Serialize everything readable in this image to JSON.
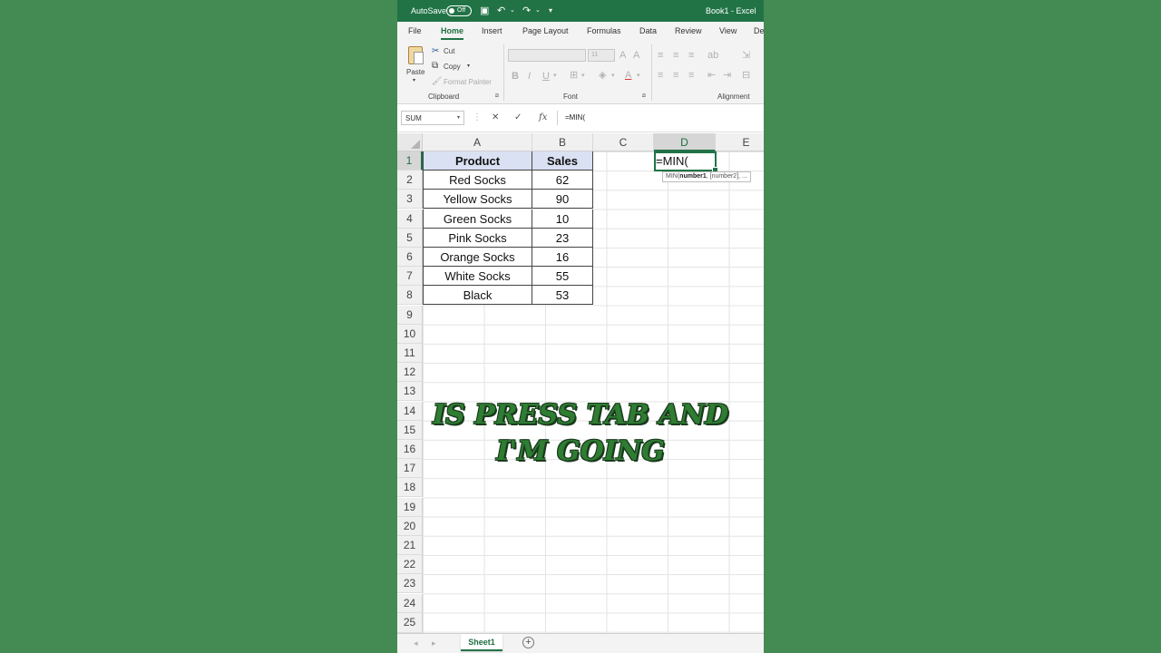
{
  "titlebar": {
    "autosave_label": "AutoSave",
    "autosave_state": "Off",
    "document": "Book1 - Excel"
  },
  "ribbon_tabs": [
    "File",
    "Home",
    "Insert",
    "Page Layout",
    "Formulas",
    "Data",
    "Review",
    "View",
    "De"
  ],
  "active_tab": "Home",
  "clipboard": {
    "paste": "Paste",
    "cut": "Cut",
    "copy": "Copy",
    "format_painter": "Format Painter",
    "group_label": "Clipboard"
  },
  "font": {
    "size": "11",
    "group_label": "Font",
    "bold": "B",
    "italic": "I",
    "underline": "U",
    "font_color": "A"
  },
  "alignment": {
    "group_label": "Alignment"
  },
  "formula_bar": {
    "name_box": "SUM",
    "cancel": "✕",
    "enter": "✓",
    "fx": "fx",
    "formula": "=MIN("
  },
  "columns": [
    "A",
    "B",
    "C",
    "D",
    "E"
  ],
  "rows": [
    "1",
    "2",
    "3",
    "4",
    "5",
    "6",
    "7",
    "8",
    "9",
    "10",
    "11",
    "12",
    "13",
    "14",
    "15",
    "16",
    "17",
    "18",
    "19",
    "20",
    "21",
    "22",
    "23",
    "24",
    "25"
  ],
  "table": {
    "headers": [
      "Product",
      "Sales"
    ],
    "rows": [
      [
        "Red Socks",
        "62"
      ],
      [
        "Yellow Socks",
        "90"
      ],
      [
        "Green Socks",
        "10"
      ],
      [
        "Pink Socks",
        "23"
      ],
      [
        "Orange Socks",
        "16"
      ],
      [
        "White Socks",
        "55"
      ],
      [
        "Black",
        "53"
      ]
    ]
  },
  "active_cell": {
    "ref": "D1",
    "content": "=MIN(",
    "tooltip_fn": "MIN(",
    "tooltip_arg1": "number1",
    "tooltip_rest": ", [number2], ..."
  },
  "caption": {
    "line1": "IS PRESS TAB AND",
    "line2": "I'M GOING"
  },
  "sheets": [
    "Sheet1"
  ],
  "colors": {
    "accent": "#217346",
    "background": "#448a53",
    "header_fill": "#d9e1f2"
  }
}
